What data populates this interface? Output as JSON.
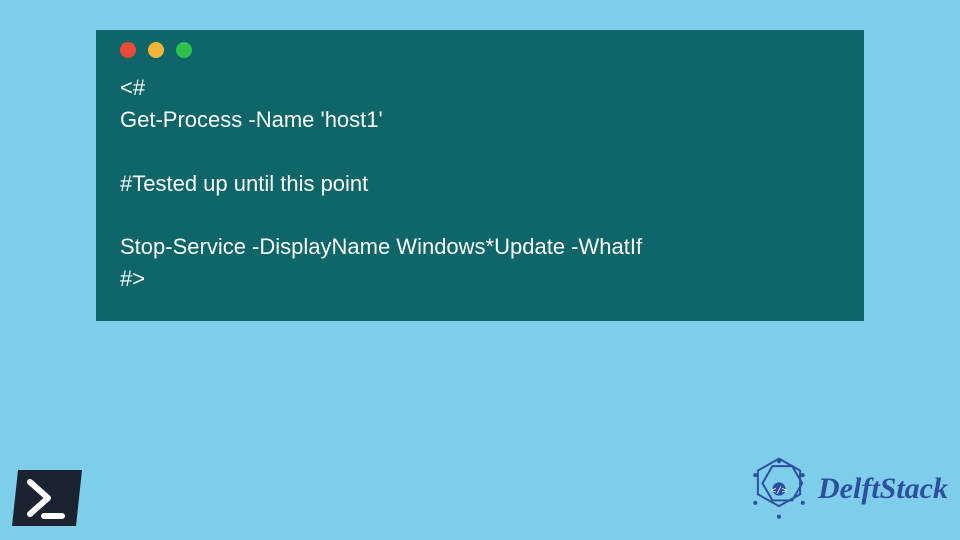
{
  "window": {
    "code_lines": [
      "<#",
      "Get-Process -Name 'host1'",
      "",
      "#Tested up until this point",
      "",
      "Stop-Service -DisplayName Windows*Update -WhatIf",
      "#>"
    ]
  },
  "brand": {
    "name": "DelftStack"
  },
  "colors": {
    "background": "#7ecdea",
    "window_bg": "#0f6668",
    "text": "#fbfdfd",
    "brand_blue": "#2d4f9e"
  },
  "icons": {
    "powershell": "powershell-icon",
    "brand_logo": "delftstack-logo"
  }
}
